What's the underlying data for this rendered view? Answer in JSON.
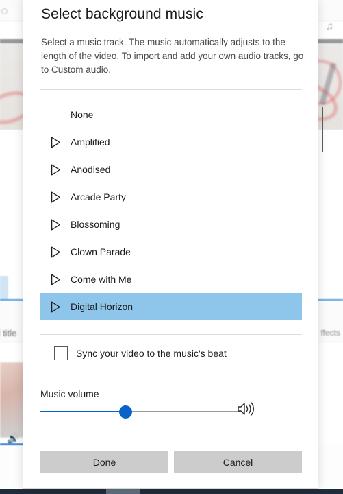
{
  "background": {
    "music_note_icon": "music-note-icon",
    "effects_label": "ffects",
    "add_title_label": "dd title",
    "thumbnail_speaker_icon": "speaker-icon"
  },
  "dialog": {
    "title": "Select background music",
    "description": "Select a music track. The music automatically adjusts to the length of the video. To import and add your own audio tracks, go to Custom audio.",
    "tracks": [
      {
        "name": "None",
        "has_play": false,
        "selected": false
      },
      {
        "name": "Amplified",
        "has_play": true,
        "selected": false
      },
      {
        "name": "Anodised",
        "has_play": true,
        "selected": false
      },
      {
        "name": "Arcade Party",
        "has_play": true,
        "selected": false
      },
      {
        "name": "Blossoming",
        "has_play": true,
        "selected": false
      },
      {
        "name": "Clown Parade",
        "has_play": true,
        "selected": false
      },
      {
        "name": "Come with Me",
        "has_play": true,
        "selected": false
      },
      {
        "name": "Digital Horizon",
        "has_play": true,
        "selected": true
      }
    ],
    "sync_checkbox": {
      "label": "Sync your video to the music's beat",
      "checked": false
    },
    "volume": {
      "label": "Music volume",
      "value": 42,
      "speaker_icon": "speaker-icon"
    },
    "buttons": {
      "done": "Done",
      "cancel": "Cancel"
    },
    "colors": {
      "selection": "#8ec5ea",
      "slider_fill": "#0a64c8",
      "button_face": "#cccccc"
    }
  }
}
